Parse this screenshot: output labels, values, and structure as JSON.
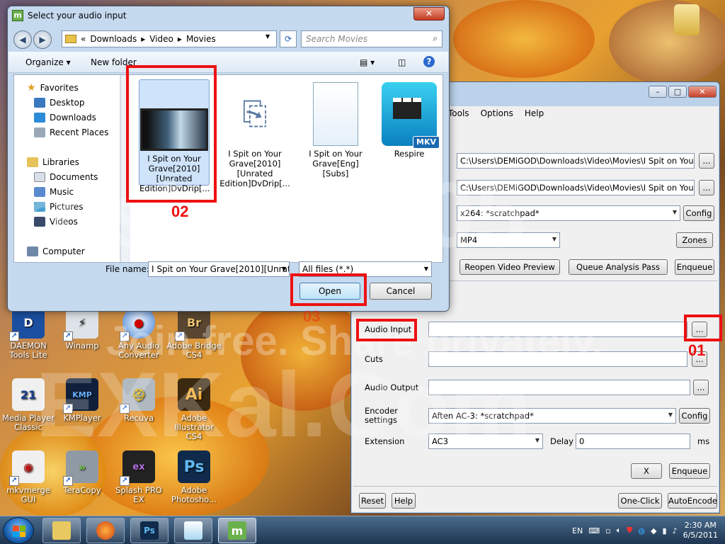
{
  "dialog": {
    "title": "Select your audio input",
    "breadcrumb": [
      "«",
      "Downloads",
      "Video",
      "Movies"
    ],
    "search_placeholder": "Search Movies",
    "organize": "Organize ▾",
    "new_folder": "New folder",
    "nav": {
      "favorites": "Favorites",
      "desktop": "Desktop",
      "downloads": "Downloads",
      "recent": "Recent Places",
      "libraries": "Libraries",
      "documents": "Documents",
      "music": "Music",
      "pictures": "Pictures",
      "videos": "Videos",
      "computer": "Computer"
    },
    "files": [
      {
        "name": "I Spit on Your Grave[2010][Unrated Edition]DvDrip[..."
      },
      {
        "name": "I Spit on Your Grave[2010][Unrated Edition]DvDrip[..."
      },
      {
        "name": "I Spit on Your Grave[Eng][Subs]"
      },
      {
        "name": "Respire"
      }
    ],
    "mkv_badge": "MKV",
    "file_name_label": "File name:",
    "file_name_value": "I Spit on Your Grave[2010][Unratec",
    "file_type": "All files (*.*)",
    "open": "Open",
    "cancel": "Cancel"
  },
  "megui": {
    "menu": [
      "Tools",
      "Options",
      "Help"
    ],
    "video_input": "C:\\Users\\DEMiGOD\\Downloads\\Video\\Movies\\I Spit on Your Grave[20",
    "video_output": "C:\\Users\\DEMiGOD\\Downloads\\Video\\Movies\\I Spit on Your Grave[20",
    "browse": "...",
    "encoder": "x264: *scratchpad*",
    "config": "Config",
    "container": "MP4",
    "zones": "Zones",
    "reopen": "Reopen Video Preview",
    "queue_analysis": "Queue Analysis Pass",
    "enqueue": "Enqueue",
    "audio_input": "Audio Input",
    "cuts": "Cuts",
    "audio_output": "Audio Output",
    "encoder_settings": "Encoder settings",
    "audio_encoder": "Aften AC-3: *scratchpad*",
    "extension_label": "Extension",
    "extension": "AC3",
    "delay_label": "Delay",
    "delay": "0",
    "ms": "ms",
    "x": "X",
    "reset": "Reset",
    "help": "Help",
    "one_click": "One-Click",
    "auto_encode": "AutoEncode"
  },
  "annotations": {
    "step1": "01",
    "step2": "02",
    "step3": "03"
  },
  "desktop_icons": [
    {
      "label": "DAEMON Tools Lite"
    },
    {
      "label": "Winamp"
    },
    {
      "label": "Any Audio Converter"
    },
    {
      "label": "Adobe Bridge CS4"
    },
    {
      "label": "Media Player Classic"
    },
    {
      "label": "KMPlayer"
    },
    {
      "label": "Recuva"
    },
    {
      "label": "Adobe Illustrator CS4"
    },
    {
      "label": "mkvmerge GUI"
    },
    {
      "label": "TeraCopy"
    },
    {
      "label": "Splash PRO EX"
    },
    {
      "label": "Adobe Photosho..."
    }
  ],
  "taskbar": {
    "lang": "EN",
    "time": "2:30 AM",
    "date": "6/5/2011"
  },
  "watermark": {
    "big": "roshanes05",
    "mid": "Join free. Share privately.",
    "low": "EXKal.Com"
  },
  "colors": {
    "annotation_red": "#e11111",
    "titlebar": "#c5d9ef"
  }
}
